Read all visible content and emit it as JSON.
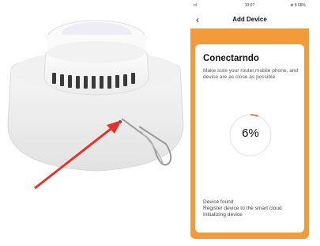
{
  "status_bar": {
    "signal": "ııl",
    "time": "10:07",
    "battery": "⊕ 8 68%"
  },
  "header": {
    "title": "Add Device"
  },
  "card": {
    "title": "Conectarndo",
    "hint": "Make sure your router,mobile phone, and device are as close as possible",
    "progress_label": "6%",
    "progress": 0.06,
    "steps": [
      "Device found",
      "Register device to the smart cloud",
      "Initializing device"
    ]
  },
  "colors": {
    "accent": "#f39a3a",
    "progress_arc": "#e8531d",
    "arrow": "#e53228"
  }
}
